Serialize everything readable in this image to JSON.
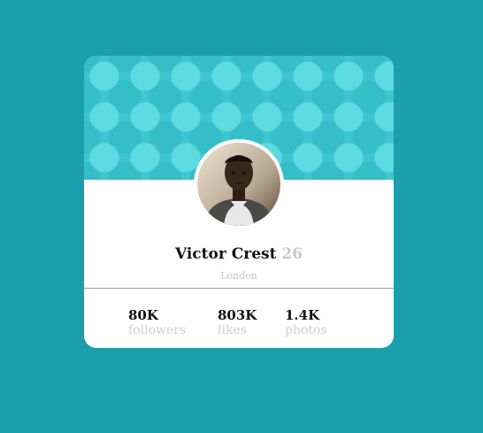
{
  "profile": {
    "name": "Victor Crest",
    "age": "26",
    "city": "London",
    "avatar_alt": "profile-photo"
  },
  "stats": [
    {
      "value": "80K",
      "label": "followers"
    },
    {
      "value": "803K",
      "label": "likes"
    },
    {
      "value": "1.4K",
      "label": "photos"
    }
  ],
  "colors": {
    "page_background": "#1b9fad",
    "header_background": "#3dc6cf",
    "card_background": "#ffffff",
    "muted_text": "#c9c9c9"
  }
}
